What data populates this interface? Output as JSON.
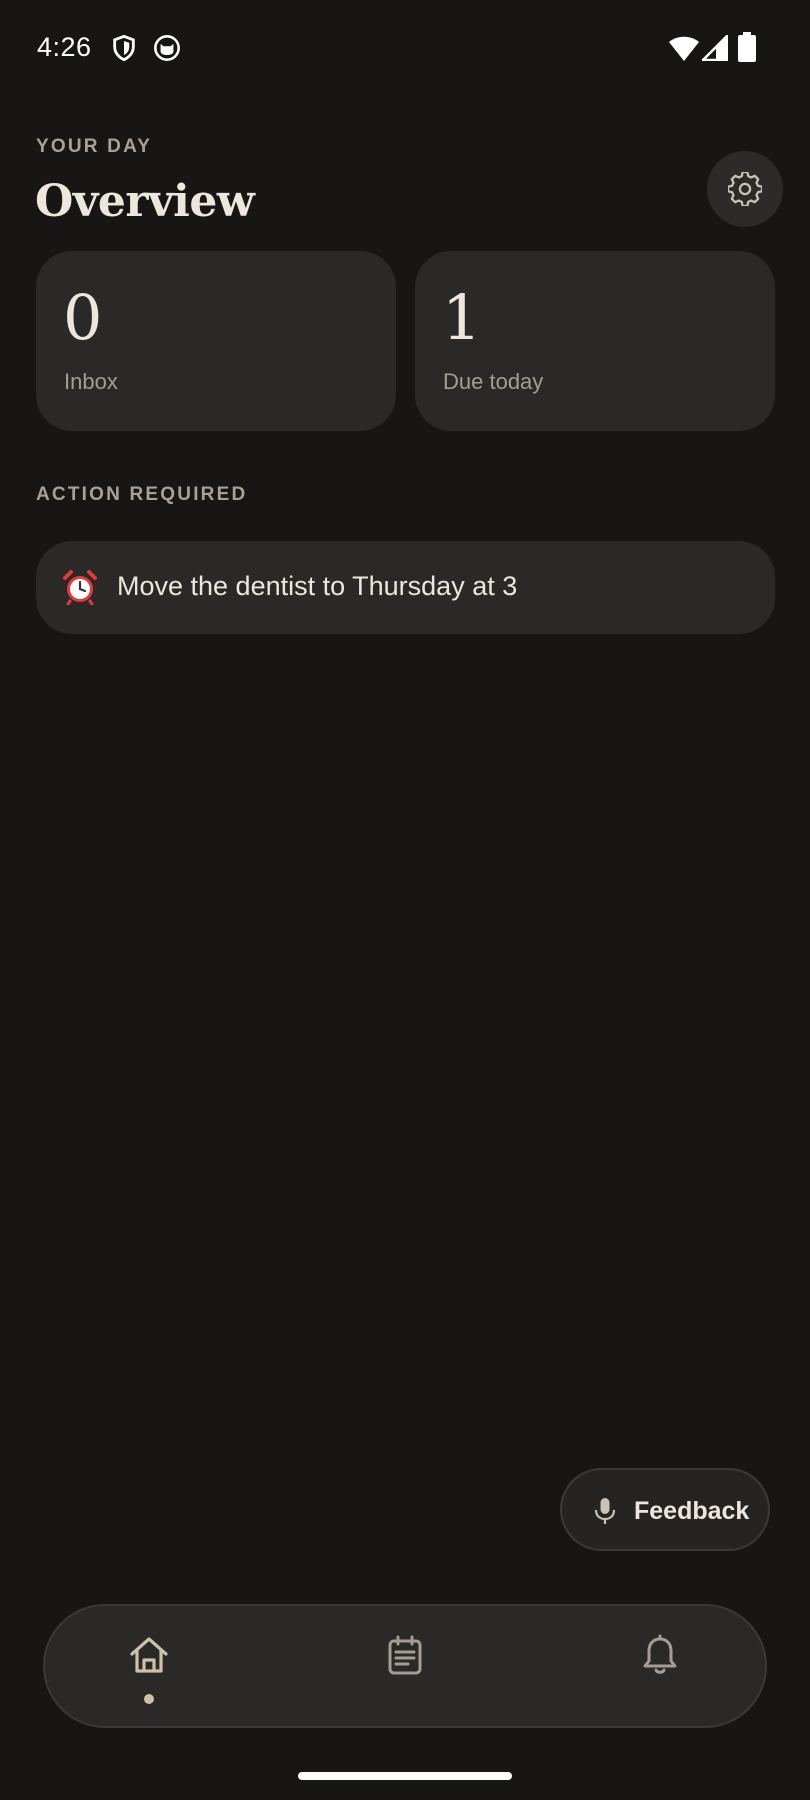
{
  "status_bar": {
    "time": "4:26",
    "icons": [
      "shield-icon",
      "cat-icon",
      "wifi-icon",
      "signal-icon",
      "battery-icon"
    ]
  },
  "header": {
    "eyebrow": "YOUR DAY",
    "title": "Overview",
    "settings_icon": "gear-icon"
  },
  "stats": [
    {
      "value": "0",
      "label": "Inbox"
    },
    {
      "value": "1",
      "label": "Due today"
    }
  ],
  "action_section": {
    "heading": "ACTION REQUIRED",
    "items": [
      {
        "icon": "alarm-clock-icon",
        "text": "Move the dentist to Thursday at 3"
      }
    ]
  },
  "feedback": {
    "icon": "microphone-icon",
    "label": "Feedback"
  },
  "bottom_nav": {
    "items": [
      {
        "icon": "home-icon",
        "active": true
      },
      {
        "icon": "notes-icon",
        "active": false
      },
      {
        "icon": "bell-icon",
        "active": false
      }
    ]
  },
  "colors": {
    "background": "#171615",
    "card": "#2a2928",
    "text_primary": "#ece6dc",
    "text_muted": "#a8a196",
    "accent": "#cfc0a8"
  }
}
